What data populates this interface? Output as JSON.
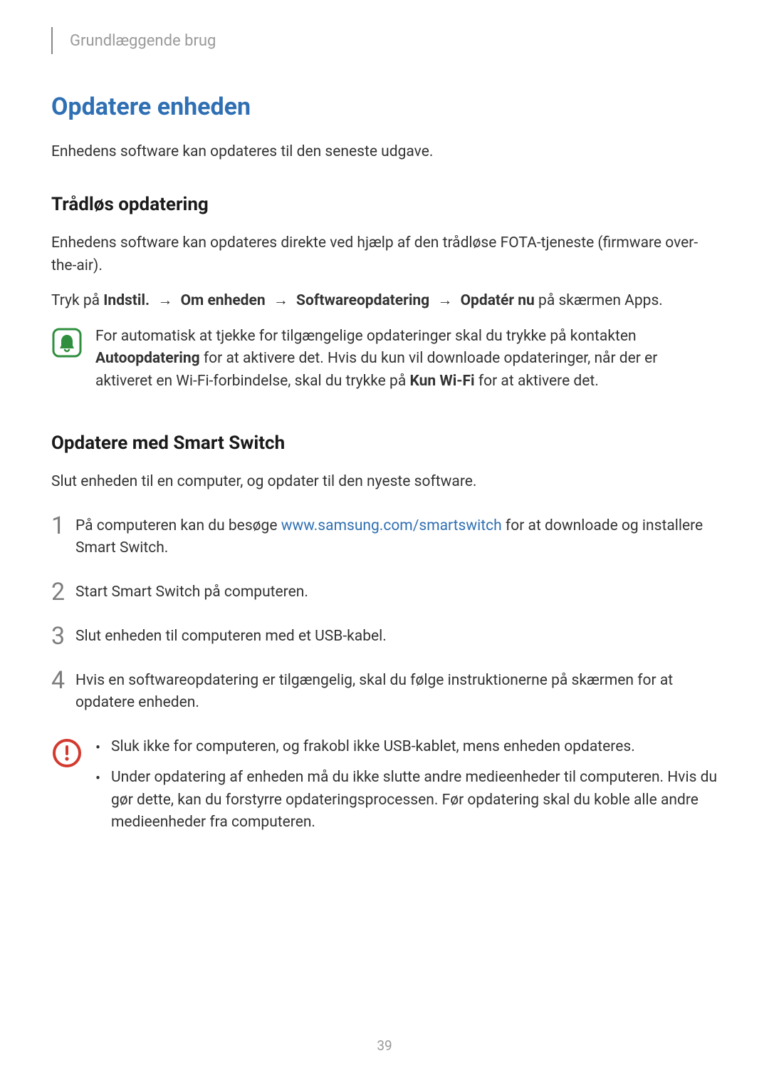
{
  "header": {
    "breadcrumb": "Grundlæggende brug"
  },
  "title": "Opdatere enheden",
  "intro": "Enhedens software kan opdateres til den seneste udgave.",
  "wireless": {
    "heading": "Trådløs opdatering",
    "para": "Enhedens software kan opdateres direkte ved hjælp af den trådløse FOTA-tjeneste (firmware over-the-air).",
    "path_prefix": "Tryk på ",
    "path_arrow": "→",
    "path_parts": {
      "a": "Indstil.",
      "b": "Om enheden",
      "c": "Softwareopdatering",
      "d": "Opdatér nu"
    },
    "path_suffix": " på skærmen Apps.",
    "note_pre": "For automatisk at tjekke for tilgængelige opdateringer skal du trykke på kontakten ",
    "note_bold1": "Autoopdatering",
    "note_mid": " for at aktivere det. Hvis du kun vil downloade opdateringer, når der er aktiveret en Wi-Fi-forbindelse, skal du trykke på ",
    "note_bold2": "Kun Wi-Fi",
    "note_post": " for at aktivere det."
  },
  "smartswitch": {
    "heading": "Opdatere med Smart Switch",
    "intro": "Slut enheden til en computer, og opdater til den nyeste software.",
    "steps": {
      "s1_pre": "På computeren kan du besøge ",
      "s1_link": "www.samsung.com/smartswitch",
      "s1_post": " for at downloade og installere Smart Switch.",
      "s2": "Start Smart Switch på computeren.",
      "s3": "Slut enheden til computeren med et USB-kabel.",
      "s4": "Hvis en softwareopdatering er tilgængelig, skal du følge instruktionerne på skærmen for at opdatere enheden."
    },
    "nums": {
      "n1": "1",
      "n2": "2",
      "n3": "3",
      "n4": "4"
    },
    "warnings": {
      "w1": "Sluk ikke for computeren, og frakobl ikke USB-kablet, mens enheden opdateres.",
      "w2": "Under opdatering af enheden må du ikke slutte andre medieenheder til computeren. Hvis du gør dette, kan du forstyrre opdateringsprocessen. Før opdatering skal du koble alle andre medieenheder fra computeren."
    }
  },
  "page_number": "39",
  "icons": {
    "note": "note-bell-icon",
    "warn": "warning-exclamation-icon"
  }
}
